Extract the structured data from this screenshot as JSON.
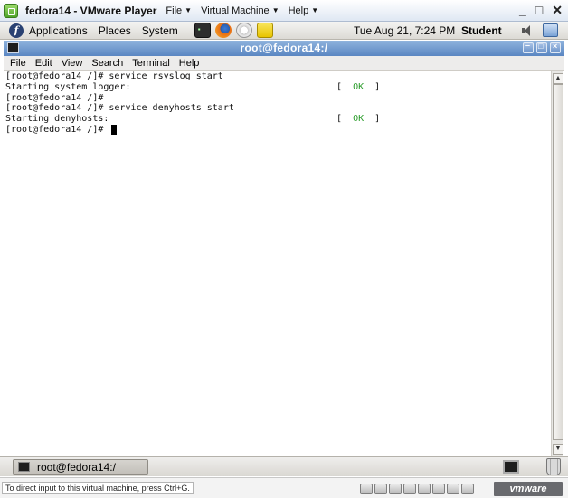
{
  "vmware": {
    "window_title": "fedora14 - VMware Player",
    "menus": [
      "File",
      "Virtual Machine",
      "Help"
    ],
    "controls": {
      "minimize": "_",
      "maximize": "□",
      "close": "✕"
    },
    "status_message": "To direct input to this virtual machine, press Ctrl+G.",
    "brand": "vmware"
  },
  "gnome_panel": {
    "menus": [
      "Applications",
      "Places",
      "System"
    ],
    "clock": "Tue Aug 21,  7:24 PM",
    "user": "Student"
  },
  "terminal": {
    "title": "root@fedora14:/",
    "menus": [
      "File",
      "Edit",
      "View",
      "Search",
      "Terminal",
      "Help"
    ],
    "lines": [
      "[root@fedora14 /]# service rsyslog start",
      "Starting system logger:",
      "[root@fedora14 /]#",
      "[root@fedora14 /]# service denyhosts start",
      "Starting denyhosts:",
      "[root@fedora14 /]# "
    ],
    "ok_statuses": [
      {
        "open": "[  ",
        "ok": "OK",
        "close": "  ]"
      },
      {
        "open": "[  ",
        "ok": "OK",
        "close": "  ]"
      }
    ]
  },
  "taskbar": {
    "window_label": "root@fedora14:/"
  },
  "colors": {
    "ok": "#2e9e2e",
    "title_bar": "#5a86c2"
  }
}
